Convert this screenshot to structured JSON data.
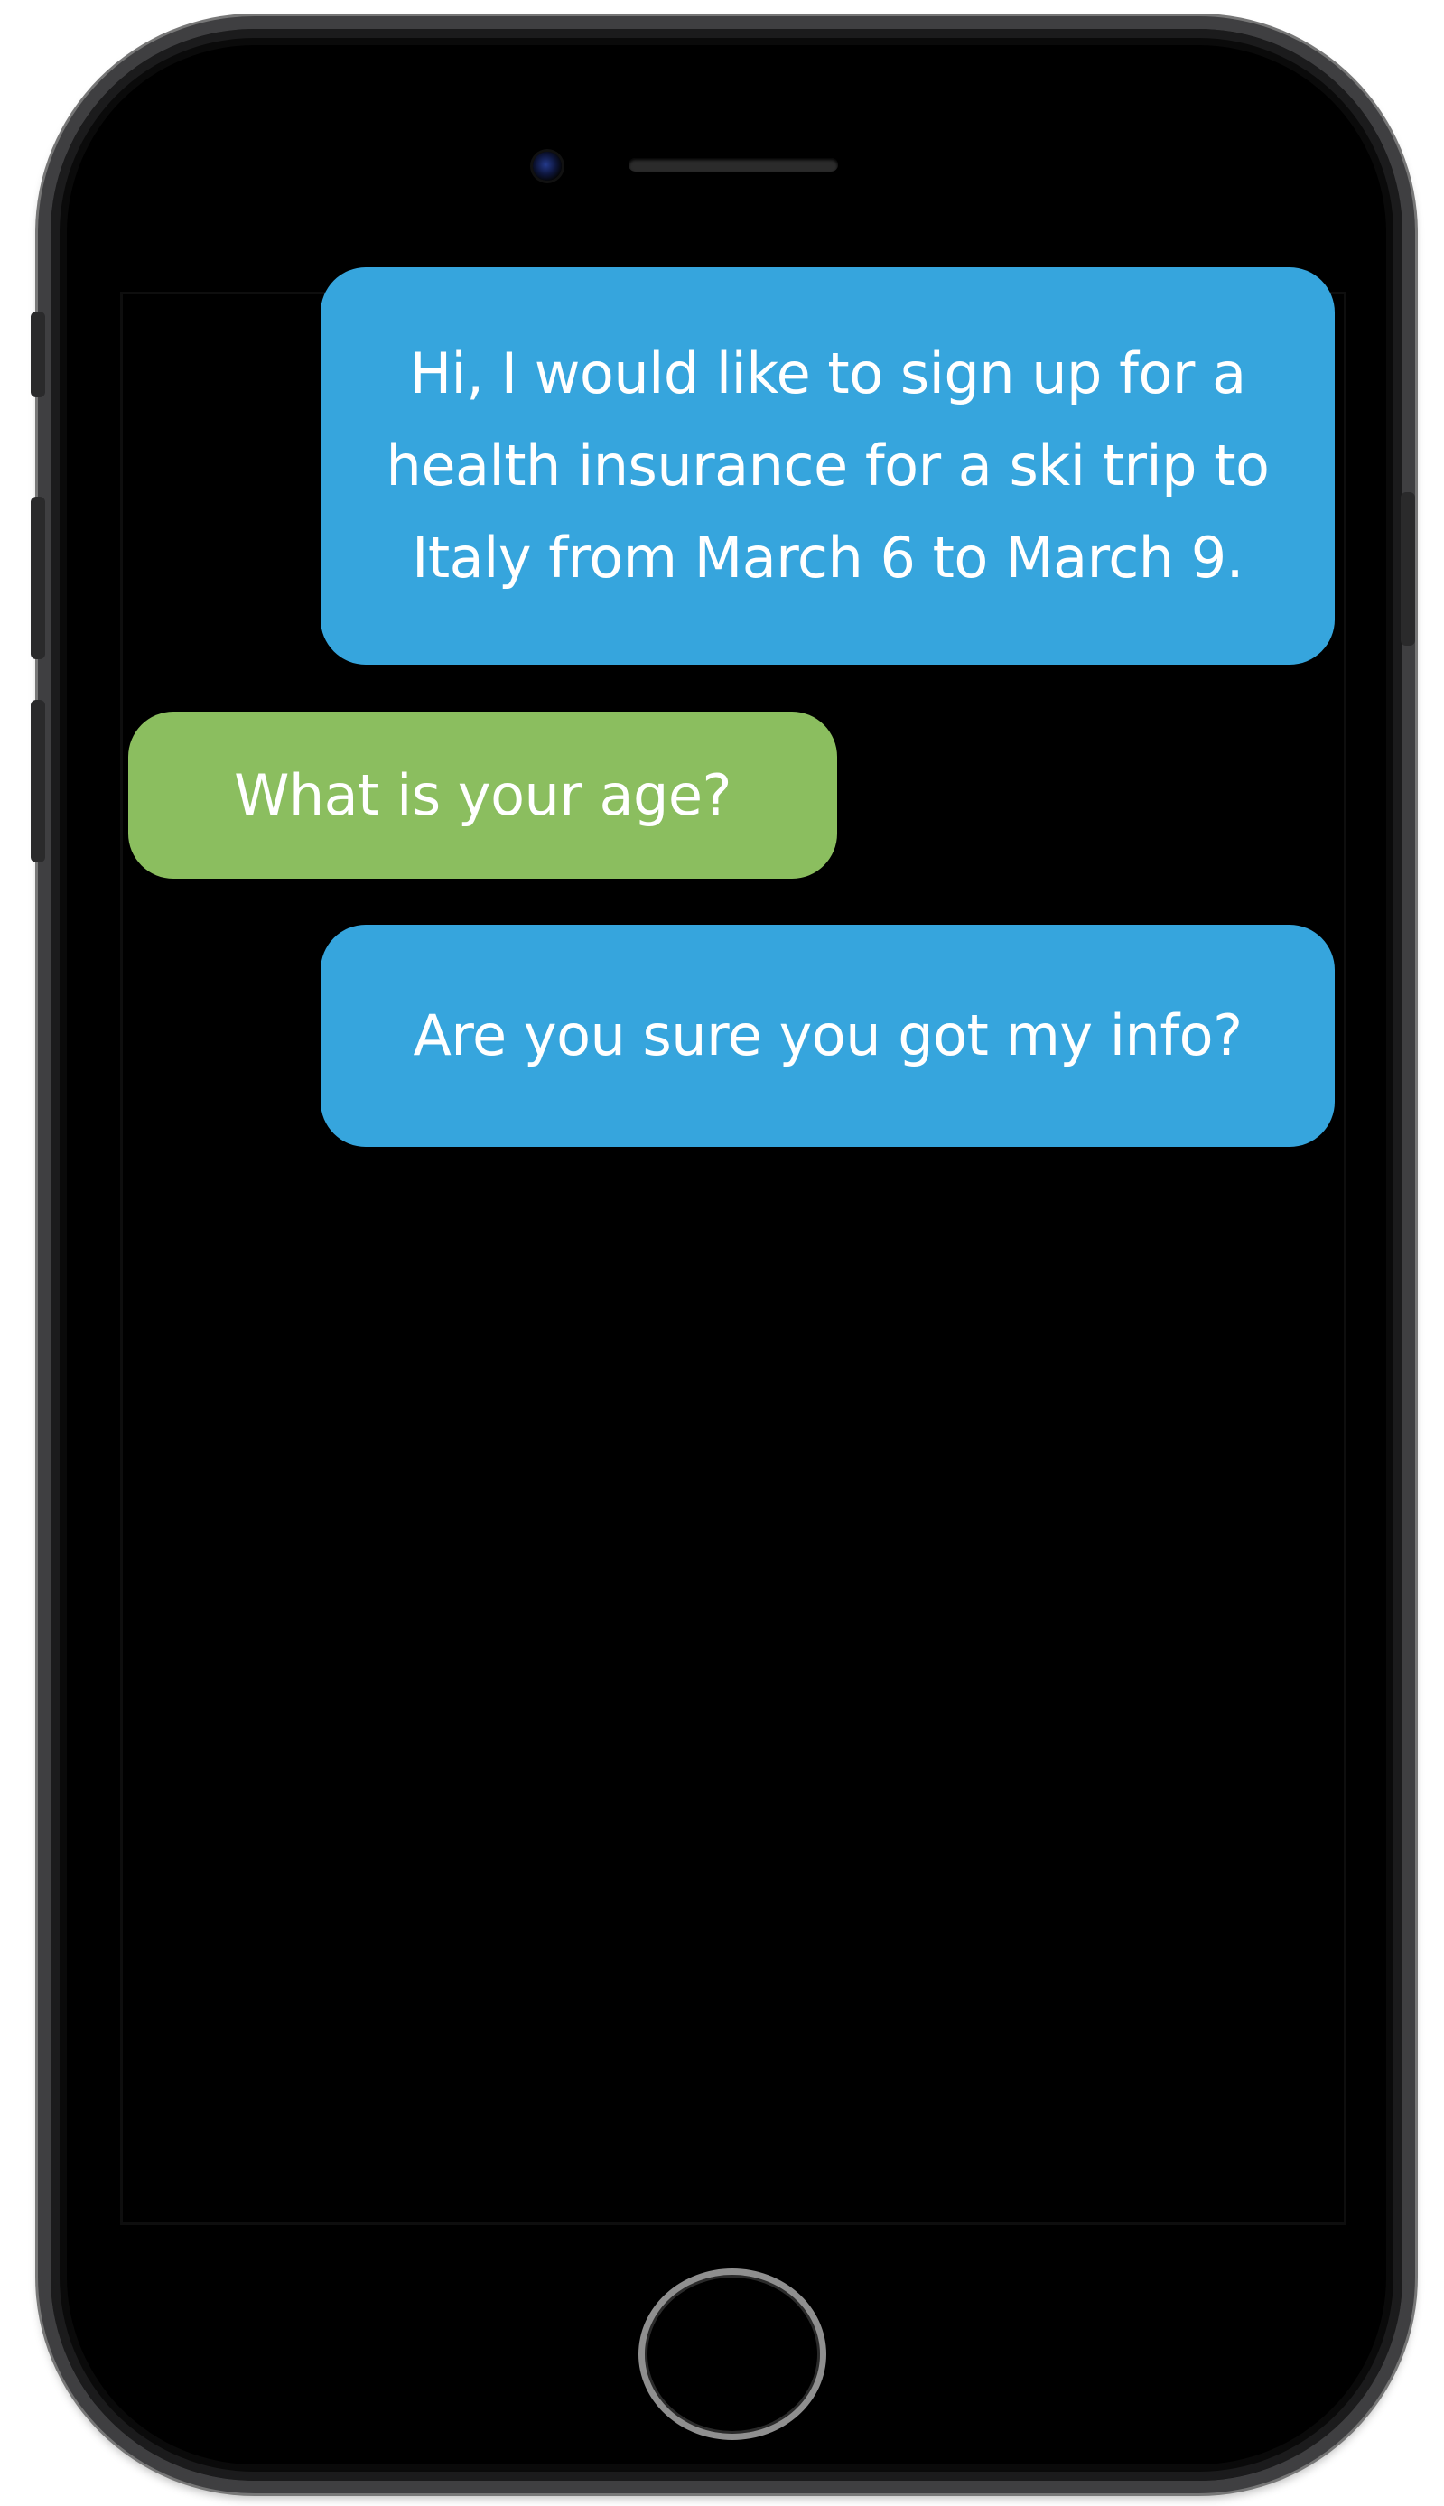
{
  "conversation": {
    "messages": [
      {
        "sender": "user",
        "text": "Hi, I would like to sign up for a health insurance for a ski trip to Italy from March 6 to March 9."
      },
      {
        "sender": "bot",
        "text": "What is your age?"
      },
      {
        "sender": "user",
        "text": "Are you sure you got my info?"
      }
    ]
  },
  "colors": {
    "user_bubble": "#36a5dd",
    "bot_bubble": "#8bbe5f",
    "screen_background": "#000000",
    "bubble_text": "#ffffff"
  }
}
